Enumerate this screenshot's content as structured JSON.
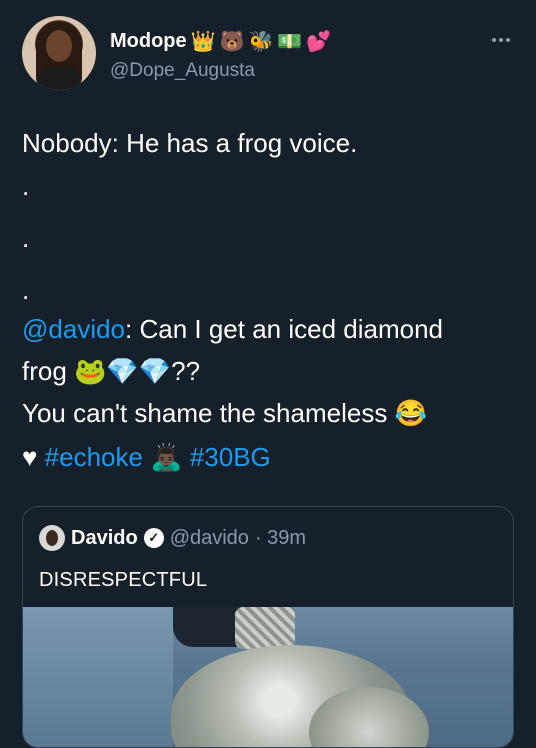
{
  "tweet": {
    "display_name": "Modope",
    "name_emojis": [
      "👑",
      "🐻",
      "🐝",
      "💵",
      "💕"
    ],
    "handle": "@Dope_Augusta",
    "lines": {
      "line1": "Nobody: He has a frog voice.",
      "dot": ".",
      "mention": "@davido",
      "line2_rest": ": Can I get an iced diamond",
      "line3_text": "frog ",
      "line3_emojis": "🐸💎💎",
      "line3_suffix": "??",
      "line4_text": "You can't shame the shameless ",
      "line4_emoji": "😂",
      "heart": "♥",
      "hashtag1": "#echoke",
      "emoji_between": "🙇🏿‍♂️",
      "hashtag2": "#30BG"
    }
  },
  "quoted_tweet": {
    "display_name": "Davido",
    "verified_icon": "✓",
    "handle": "@davido",
    "time": "· 39m",
    "text": "DISRESPECTFUL"
  }
}
